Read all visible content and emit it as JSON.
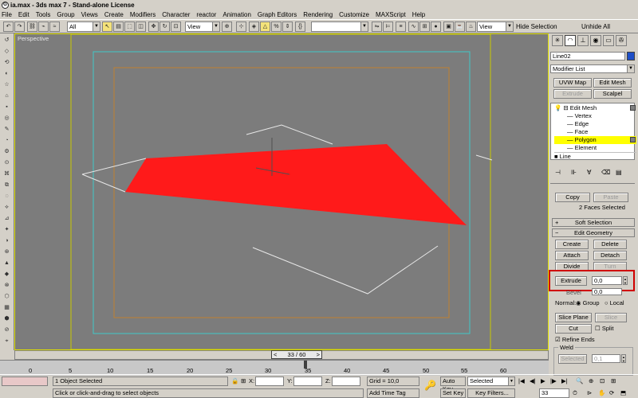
{
  "window": {
    "title": "ia.max - 3ds max 7 - Stand-alone License",
    "icon": "3ds-max-logo-icon"
  },
  "menu": [
    "File",
    "Edit",
    "Tools",
    "Group",
    "Views",
    "Create",
    "Modifiers",
    "Character",
    "reactor",
    "Animation",
    "Graph Editors",
    "Rendering",
    "Customize",
    "MAXScript",
    "Help"
  ],
  "toolbar": {
    "selection_filter": "All",
    "ref_coord": "View",
    "named_selection": "",
    "view_combo": "View",
    "hide_selection": "Hide Selection",
    "unhide_all": "Unhide All"
  },
  "viewport": {
    "label": "Perspective"
  },
  "panel": {
    "object_name": "Line02",
    "object_color": "#1e4fc8",
    "modifier_list": "Modifier List",
    "buttons": {
      "uvw_map": "UVW Map",
      "edit_mesh": "Edit Mesh",
      "extrude": "Extrude",
      "scalpel": "Scalpel"
    },
    "stack": {
      "edit_mesh": "Edit Mesh",
      "vertex": "Vertex",
      "edge": "Edge",
      "face": "Face",
      "polygon": "Polygon",
      "element": "Element",
      "line": "Line"
    },
    "selection": {
      "copy": "Copy",
      "paste": "Paste",
      "info": "2 Faces Selected"
    },
    "soft_selection": "Soft Selection",
    "edit_geometry": {
      "title": "Edit Geometry",
      "create": "Create",
      "delete": "Delete",
      "attach": "Attach",
      "detach": "Detach",
      "divide": "Divide",
      "turn": "Turn",
      "extrude": "Extrude",
      "extrude_value": "0,0",
      "bevel": "Bevel",
      "bevel_value": "0,0",
      "normal_label": "Normal:",
      "group": "Group",
      "local": "Local",
      "slice_plane": "Slice Plane",
      "slice": "Slice",
      "cut": "Cut",
      "split": "Split",
      "refine_ends": "Refine Ends",
      "weld_title": "Weld",
      "weld_selected": "Selected",
      "weld_value": "0,1"
    }
  },
  "timeline": {
    "frame": "33 / 60",
    "ticks": [
      "0",
      "5",
      "10",
      "15",
      "20",
      "25",
      "30",
      "35",
      "40",
      "45",
      "50",
      "55",
      "60"
    ]
  },
  "status": {
    "objects": "1 Object Selected",
    "prompt": "Click or click-and-drag to select objects",
    "x_label": "X:",
    "y_label": "Y:",
    "z_label": "Z:",
    "grid": "Grid = 10,0",
    "add_time_tag": "Add Time Tag",
    "auto_key": "Auto Key",
    "set_key": "Set Key",
    "selected": "Selected",
    "key_filters": "Key Filters...",
    "current_frame": "33"
  },
  "colors": {
    "polygon": "#ff1a1a",
    "highlight": "#ffff00",
    "callout": "#d00000",
    "safe_frame_outer": "#c8c800",
    "safe_frame_mid": "#40c8c8",
    "safe_frame_inner": "#c08030"
  }
}
